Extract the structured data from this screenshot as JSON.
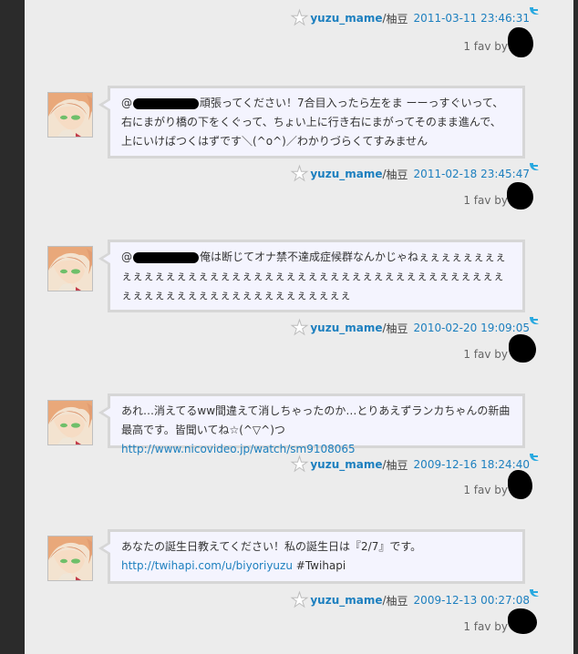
{
  "user": {
    "username": "yuzu_mame",
    "display_name": "柚豆"
  },
  "fav_label": "1 fav by",
  "top_entry": {
    "timestamp": "2011-03-11 23:46:31"
  },
  "tweets": [
    {
      "mention": "@",
      "text": "頑張ってください！7合目入ったら左をま ーーっすぐいって、右にまがり橋の下をくぐって、ちょい上に行き右にまがってそのまま進んで、上にいけばつくはずです＼(^о^)／わかりづらくてすみません",
      "timestamp": "2011-02-18 23:45:47"
    },
    {
      "mention": "@",
      "text": "俺は断じてオナ禁不達成症候群なんかじゃねぇぇぇぇぇぇぇぇぇぇぇぇぇぇぇぇぇぇぇぇぇぇぇぇぇぇぇぇぇぇぇぇぇぇぇぇぇぇぇぇぇぇぇぇぇぇぇぇぇぇぇぇぇぇぇぇぇぇぇぇぇぇぇぇ",
      "timestamp": "2010-02-20 19:09:05"
    },
    {
      "text": "あれ…消えてるww間違えて消しちゃったのか…とりあえずランカちゃんの新曲最高です。皆聞いてね☆(^▽^)つ",
      "link": "http://www.nicovideo.jp/watch/sm9108065",
      "timestamp": "2009-12-16 18:24:40"
    },
    {
      "text": "あなたの誕生日教えてください！私の誕生日は『2/7』です。",
      "link": "http://twihapi.com/u/biyoriyuzu",
      "hashtag": "#Twihapi",
      "timestamp": "2009-12-13 00:27:08"
    }
  ],
  "icons": {
    "fav": "star-icon",
    "source": "twitter-bird-icon"
  },
  "colors": {
    "link": "#1c7fbf",
    "bubble_bg": "#f4f4fe",
    "bubble_border": "#d6d6d6",
    "frame": "#2b2b2b"
  }
}
